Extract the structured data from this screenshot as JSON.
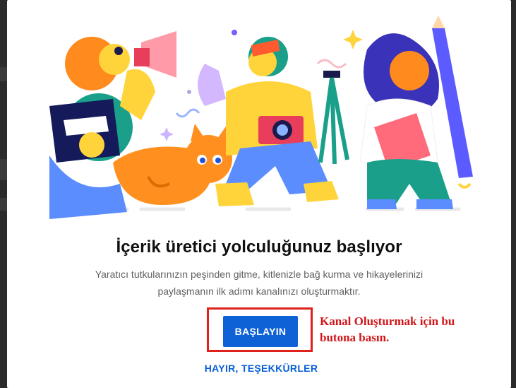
{
  "dialog": {
    "title": "İçerik üretici yolculuğunuz başlıyor",
    "description_line1": "Yaratıcı tutkularınızın peşinden gitme, kitlenizle bağ kurma ve hikayelerinizi",
    "description_line2": "paylaşmanın ilk adımı kanalınızı oluşturmaktır.",
    "start_button_label": "BAŞLAYIN",
    "no_thanks_label": "HAYIR, TEŞEKKÜRLER"
  },
  "annotation": {
    "line1": "Kanal Oluşturmak için bu",
    "line2": "butona basın."
  },
  "colors": {
    "primary_button": "#0f62d6",
    "link": "#065fd4",
    "annotation_red": "#d1151a"
  },
  "icons": {
    "illustration": "creators-illustration"
  }
}
